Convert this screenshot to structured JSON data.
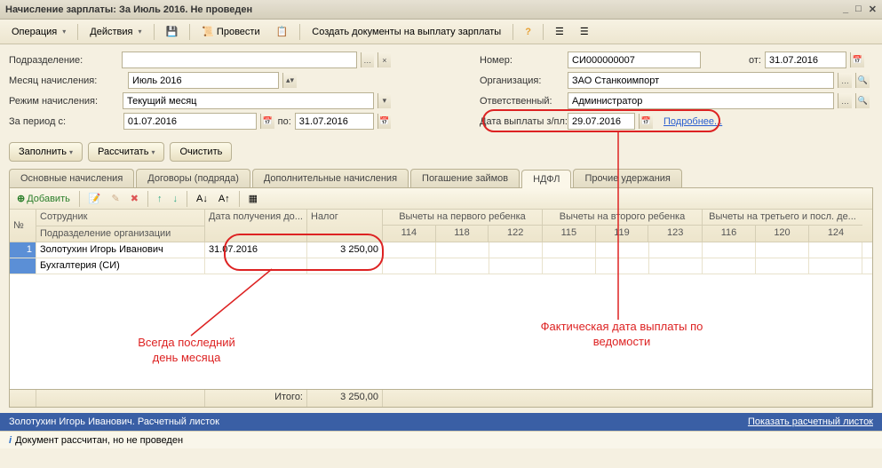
{
  "title": "Начисление зарплаты: За Июль 2016. Не проведен",
  "toolbar": {
    "operation": "Операция",
    "actions": "Действия",
    "provesti": "Провести",
    "create_docs": "Создать документы на выплату зарплаты"
  },
  "form": {
    "l_subdiv": "Подразделение:",
    "l_month": "Месяц начисления:",
    "v_month": "Июль 2016",
    "l_mode": "Режим начисления:",
    "v_mode": "Текущий месяц",
    "l_period": "За период с:",
    "v_period_from": "01.07.2016",
    "l_to": "по:",
    "v_period_to": "31.07.2016",
    "l_number": "Номер:",
    "v_number": "СИ000000007",
    "l_from": "от:",
    "v_from": "31.07.2016",
    "l_org": "Организация:",
    "v_org": "ЗАО Станкоимпорт",
    "l_resp": "Ответственный:",
    "v_resp": "Администратор",
    "l_paydate": "Дата выплаты з/пл:",
    "v_paydate": "29.07.2016",
    "link_more": "Подробнее..."
  },
  "buttons": {
    "fill": "Заполнить",
    "calc": "Рассчитать",
    "clear": "Очистить"
  },
  "tabs": {
    "t1": "Основные начисления",
    "t2": "Договоры (подряда)",
    "t3": "Дополнительные начисления",
    "t4": "Погашение займов",
    "t5": "НДФЛ",
    "t6": "Прочие удержания"
  },
  "grid": {
    "add": "Добавить",
    "h_num": "№",
    "h_emp": "Сотрудник",
    "h_subdiv": "Подразделение организации",
    "h_date": "Дата получения до...",
    "h_tax": "Налог",
    "h_g1": "Вычеты на первого ребенка",
    "h_g2": "Вычеты на второго ребенка",
    "h_g3": "Вычеты на третьего и посл. де...",
    "s114": "114",
    "s118": "118",
    "s122": "122",
    "s115": "115",
    "s119": "119",
    "s123": "123",
    "s116": "116",
    "s120": "120",
    "s124": "124",
    "row_num": "1",
    "row_emp": "Золотухин Игорь Иванович",
    "row_dept": "Бухгалтерия (СИ)",
    "row_date": "31.07.2016",
    "row_tax": "3 250,00",
    "footer_label": "Итого:",
    "footer_tax": "3 250,00"
  },
  "status": {
    "line1_left": "Золотухин Игорь Иванович. Расчетный листок",
    "line1_right": "Показать расчетный листок",
    "line2": "Документ рассчитан, но не проведен"
  },
  "anno": {
    "t1": "Всегда последний\nдень месяца",
    "t2": "Фактическая дата выплаты по\nведомости"
  }
}
